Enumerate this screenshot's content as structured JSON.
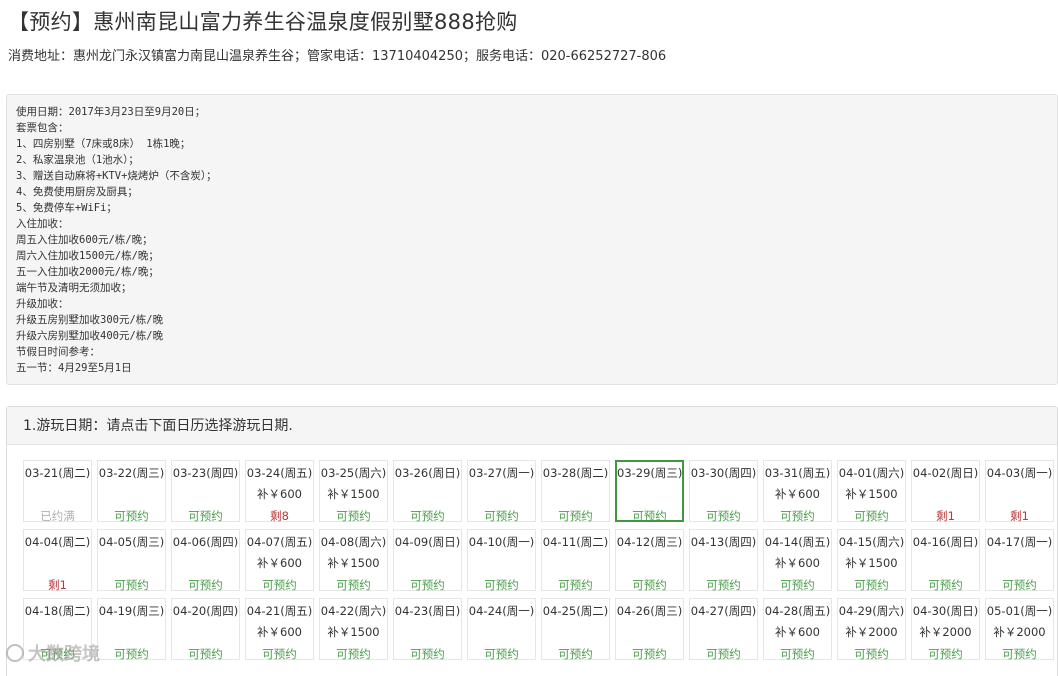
{
  "header": {
    "title": "【预约】惠州南昆山富力养生谷温泉度假别墅888抢购",
    "subinfo": "消费地址：惠州龙门永汉镇富力南昆山温泉养生谷；管家电话：13710404250；服务电话：020-66252727-806"
  },
  "info": {
    "lines": [
      "使用日期：2017年3月23日至9月20日；",
      "套票包含：",
      "1、四房别墅（7床或8床） 1栋1晚；",
      "2、私家温泉池（1池水）；",
      "3、赠送自动麻将+KTV+烧烤炉（不含炭）；",
      "4、免费使用厨房及厨具；",
      "5、免费停车+WiFi；",
      "入住加收：",
      "周五入住加收600元/栋/晚；",
      "周六入住加收1500元/栋/晚；",
      "五一入住加收2000元/栋/晚；",
      "端午节及清明无须加收；",
      "升级加收：",
      "升级五房别墅加收300元/栋/晚",
      "升级六房别墅加收400元/栋/晚",
      "节假日时间参考：",
      "五一节：4月29至5月1日"
    ]
  },
  "calendar": {
    "heading": "1.游玩日期：请点击下面日历选择游玩日期.",
    "rows": [
      [
        {
          "date": "03-21(周二)",
          "price": "",
          "status": "已约满",
          "kind": "full"
        },
        {
          "date": "03-22(周三)",
          "price": "",
          "status": "可预约",
          "kind": "ok"
        },
        {
          "date": "03-23(周四)",
          "price": "",
          "status": "可预约",
          "kind": "ok"
        },
        {
          "date": "03-24(周五)",
          "price": "补￥600",
          "status": "剩8",
          "kind": "left"
        },
        {
          "date": "03-25(周六)",
          "price": "补￥1500",
          "status": "可预约",
          "kind": "ok"
        },
        {
          "date": "03-26(周日)",
          "price": "",
          "status": "可预约",
          "kind": "ok"
        },
        {
          "date": "03-27(周一)",
          "price": "",
          "status": "可预约",
          "kind": "ok"
        },
        {
          "date": "03-28(周二)",
          "price": "",
          "status": "可预约",
          "kind": "ok"
        },
        {
          "date": "03-29(周三)",
          "price": "",
          "status": "可预约",
          "kind": "ok",
          "selected": true
        },
        {
          "date": "03-30(周四)",
          "price": "",
          "status": "可预约",
          "kind": "ok"
        },
        {
          "date": "03-31(周五)",
          "price": "补￥600",
          "status": "可预约",
          "kind": "ok"
        },
        {
          "date": "04-01(周六)",
          "price": "补￥1500",
          "status": "可预约",
          "kind": "ok"
        },
        {
          "date": "04-02(周日)",
          "price": "",
          "status": "剩1",
          "kind": "left"
        },
        {
          "date": "04-03(周一)",
          "price": "",
          "status": "剩1",
          "kind": "left"
        }
      ],
      [
        {
          "date": "04-04(周二)",
          "price": "",
          "status": "剩1",
          "kind": "left"
        },
        {
          "date": "04-05(周三)",
          "price": "",
          "status": "可预约",
          "kind": "ok"
        },
        {
          "date": "04-06(周四)",
          "price": "",
          "status": "可预约",
          "kind": "ok"
        },
        {
          "date": "04-07(周五)",
          "price": "补￥600",
          "status": "可预约",
          "kind": "ok"
        },
        {
          "date": "04-08(周六)",
          "price": "补￥1500",
          "status": "可预约",
          "kind": "ok"
        },
        {
          "date": "04-09(周日)",
          "price": "",
          "status": "可预约",
          "kind": "ok"
        },
        {
          "date": "04-10(周一)",
          "price": "",
          "status": "可预约",
          "kind": "ok"
        },
        {
          "date": "04-11(周二)",
          "price": "",
          "status": "可预约",
          "kind": "ok"
        },
        {
          "date": "04-12(周三)",
          "price": "",
          "status": "可预约",
          "kind": "ok"
        },
        {
          "date": "04-13(周四)",
          "price": "",
          "status": "可预约",
          "kind": "ok"
        },
        {
          "date": "04-14(周五)",
          "price": "补￥600",
          "status": "可预约",
          "kind": "ok"
        },
        {
          "date": "04-15(周六)",
          "price": "补￥1500",
          "status": "可预约",
          "kind": "ok"
        },
        {
          "date": "04-16(周日)",
          "price": "",
          "status": "可预约",
          "kind": "ok"
        },
        {
          "date": "04-17(周一)",
          "price": "",
          "status": "可预约",
          "kind": "ok"
        }
      ],
      [
        {
          "date": "04-18(周二)",
          "price": "",
          "status": "可预约",
          "kind": "ok"
        },
        {
          "date": "04-19(周三)",
          "price": "",
          "status": "可预约",
          "kind": "ok"
        },
        {
          "date": "04-20(周四)",
          "price": "",
          "status": "可预约",
          "kind": "ok"
        },
        {
          "date": "04-21(周五)",
          "price": "补￥600",
          "status": "可预约",
          "kind": "ok"
        },
        {
          "date": "04-22(周六)",
          "price": "补￥1500",
          "status": "可预约",
          "kind": "ok"
        },
        {
          "date": "04-23(周日)",
          "price": "",
          "status": "可预约",
          "kind": "ok"
        },
        {
          "date": "04-24(周一)",
          "price": "",
          "status": "可预约",
          "kind": "ok"
        },
        {
          "date": "04-25(周二)",
          "price": "",
          "status": "可预约",
          "kind": "ok"
        },
        {
          "date": "04-26(周三)",
          "price": "",
          "status": "可预约",
          "kind": "ok"
        },
        {
          "date": "04-27(周四)",
          "price": "",
          "status": "可预约",
          "kind": "ok"
        },
        {
          "date": "04-28(周五)",
          "price": "补￥600",
          "status": "可预约",
          "kind": "ok"
        },
        {
          "date": "04-29(周六)",
          "price": "补￥2000",
          "status": "可预约",
          "kind": "ok"
        },
        {
          "date": "04-30(周日)",
          "price": "补￥2000",
          "status": "可预约",
          "kind": "ok"
        },
        {
          "date": "05-01(周一)",
          "price": "补￥2000",
          "status": "可预约",
          "kind": "ok"
        }
      ]
    ]
  },
  "watermark": {
    "text": "大数跨境"
  },
  "colors": {
    "available": "#4a9d4a",
    "full": "#b0b0b0",
    "remaining": "#b83a3a",
    "selected_border": "#3c9a3c"
  }
}
